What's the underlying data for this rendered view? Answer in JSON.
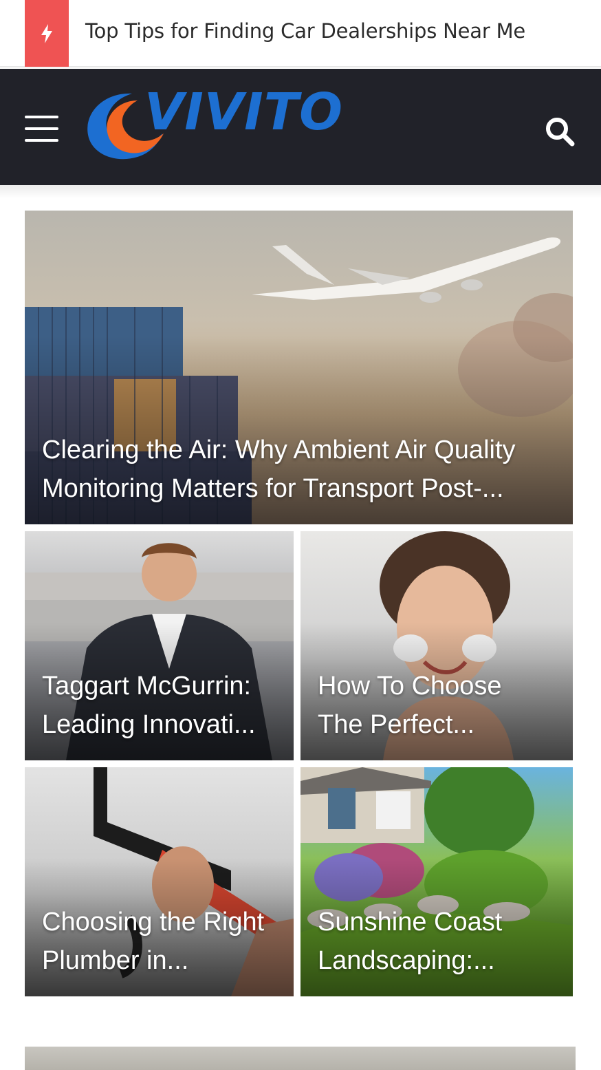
{
  "ticker": {
    "icon": "bolt-icon",
    "badge_color": "#ef5353",
    "headline": "Top Tips for Finding Car Dealerships Near Me"
  },
  "header": {
    "background": "#212229",
    "logo_text": "VIVITO",
    "logo_colors": {
      "blue": "#1d6fd1",
      "orange": "#f26522"
    },
    "menu_icon": "hamburger-menu-icon",
    "search_icon": "search-icon"
  },
  "featured": {
    "title_line1": "Clearing the Air: Why Ambient Air Quality",
    "title_line2": "Monitoring Matters for Transport Post-..."
  },
  "posts": [
    {
      "title_line1": "Taggart McGurrin:",
      "title_line2": "Leading Innovati..."
    },
    {
      "title_line1": "How To Choose",
      "title_line2": "The Perfect..."
    },
    {
      "title_line1": "Choosing the Right",
      "title_line2": "Plumber in..."
    },
    {
      "title_line1": "Sunshine Coast",
      "title_line2": "Landscaping:..."
    }
  ]
}
